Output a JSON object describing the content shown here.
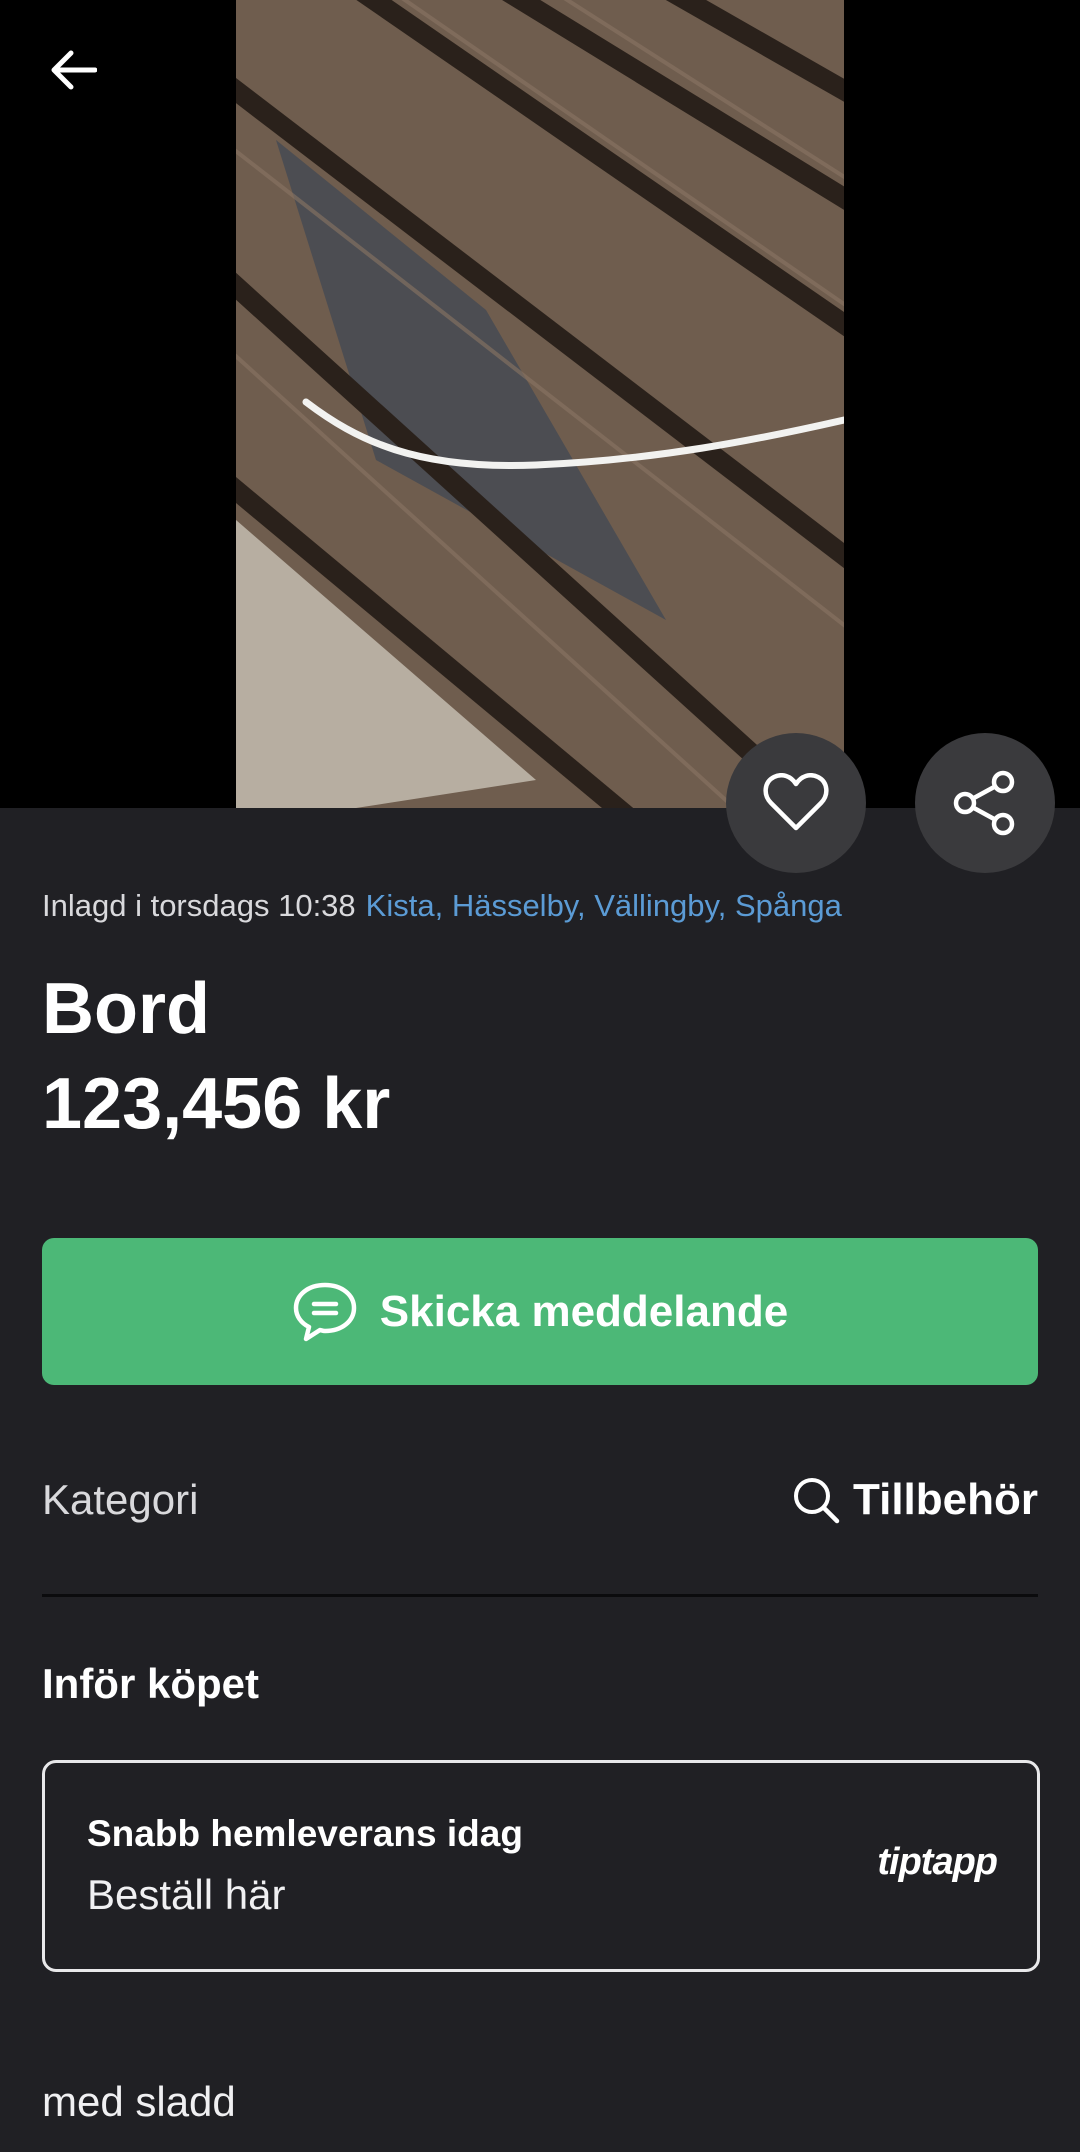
{
  "listing": {
    "posted": "Inlagd i torsdags 10:38",
    "location": "Kista, Hässelby, Vällingby, Spånga",
    "title": "Bord",
    "price": "123,456 kr"
  },
  "actions": {
    "send_message": "Skicka meddelande"
  },
  "category": {
    "label": "Kategori",
    "value": "Tillbehör"
  },
  "purchase": {
    "heading": "Inför köpet",
    "card_title": "Snabb hemleverans idag",
    "card_subtitle": "Beställ här",
    "brand": "tiptapp"
  },
  "description": "med sladd",
  "icons": {
    "back": "arrow-left-icon",
    "favorite": "heart-icon",
    "share": "share-icon",
    "message": "chat-bubble-icon",
    "search": "search-icon"
  },
  "colors": {
    "background": "#202024",
    "accent_green": "#4cb877",
    "link_blue": "#5b9bd5",
    "round_button": "#3a3a3d"
  }
}
